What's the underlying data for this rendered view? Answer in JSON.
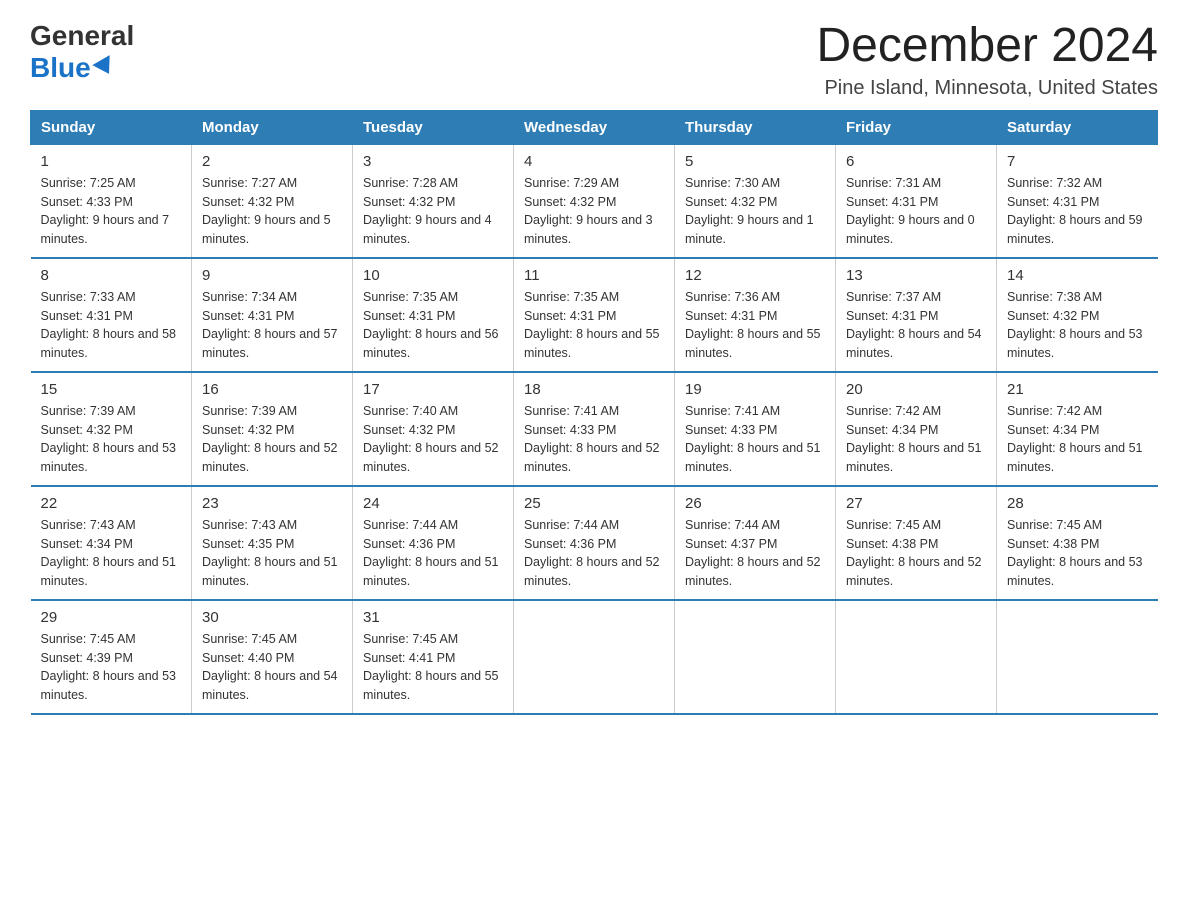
{
  "logo": {
    "general": "General",
    "blue": "Blue"
  },
  "header": {
    "month": "December 2024",
    "location": "Pine Island, Minnesota, United States"
  },
  "days_of_week": [
    "Sunday",
    "Monday",
    "Tuesday",
    "Wednesday",
    "Thursday",
    "Friday",
    "Saturday"
  ],
  "weeks": [
    [
      {
        "day": "1",
        "sunrise": "7:25 AM",
        "sunset": "4:33 PM",
        "daylight": "9 hours and 7 minutes."
      },
      {
        "day": "2",
        "sunrise": "7:27 AM",
        "sunset": "4:32 PM",
        "daylight": "9 hours and 5 minutes."
      },
      {
        "day": "3",
        "sunrise": "7:28 AM",
        "sunset": "4:32 PM",
        "daylight": "9 hours and 4 minutes."
      },
      {
        "day": "4",
        "sunrise": "7:29 AM",
        "sunset": "4:32 PM",
        "daylight": "9 hours and 3 minutes."
      },
      {
        "day": "5",
        "sunrise": "7:30 AM",
        "sunset": "4:32 PM",
        "daylight": "9 hours and 1 minute."
      },
      {
        "day": "6",
        "sunrise": "7:31 AM",
        "sunset": "4:31 PM",
        "daylight": "9 hours and 0 minutes."
      },
      {
        "day": "7",
        "sunrise": "7:32 AM",
        "sunset": "4:31 PM",
        "daylight": "8 hours and 59 minutes."
      }
    ],
    [
      {
        "day": "8",
        "sunrise": "7:33 AM",
        "sunset": "4:31 PM",
        "daylight": "8 hours and 58 minutes."
      },
      {
        "day": "9",
        "sunrise": "7:34 AM",
        "sunset": "4:31 PM",
        "daylight": "8 hours and 57 minutes."
      },
      {
        "day": "10",
        "sunrise": "7:35 AM",
        "sunset": "4:31 PM",
        "daylight": "8 hours and 56 minutes."
      },
      {
        "day": "11",
        "sunrise": "7:35 AM",
        "sunset": "4:31 PM",
        "daylight": "8 hours and 55 minutes."
      },
      {
        "day": "12",
        "sunrise": "7:36 AM",
        "sunset": "4:31 PM",
        "daylight": "8 hours and 55 minutes."
      },
      {
        "day": "13",
        "sunrise": "7:37 AM",
        "sunset": "4:31 PM",
        "daylight": "8 hours and 54 minutes."
      },
      {
        "day": "14",
        "sunrise": "7:38 AM",
        "sunset": "4:32 PM",
        "daylight": "8 hours and 53 minutes."
      }
    ],
    [
      {
        "day": "15",
        "sunrise": "7:39 AM",
        "sunset": "4:32 PM",
        "daylight": "8 hours and 53 minutes."
      },
      {
        "day": "16",
        "sunrise": "7:39 AM",
        "sunset": "4:32 PM",
        "daylight": "8 hours and 52 minutes."
      },
      {
        "day": "17",
        "sunrise": "7:40 AM",
        "sunset": "4:32 PM",
        "daylight": "8 hours and 52 minutes."
      },
      {
        "day": "18",
        "sunrise": "7:41 AM",
        "sunset": "4:33 PM",
        "daylight": "8 hours and 52 minutes."
      },
      {
        "day": "19",
        "sunrise": "7:41 AM",
        "sunset": "4:33 PM",
        "daylight": "8 hours and 51 minutes."
      },
      {
        "day": "20",
        "sunrise": "7:42 AM",
        "sunset": "4:34 PM",
        "daylight": "8 hours and 51 minutes."
      },
      {
        "day": "21",
        "sunrise": "7:42 AM",
        "sunset": "4:34 PM",
        "daylight": "8 hours and 51 minutes."
      }
    ],
    [
      {
        "day": "22",
        "sunrise": "7:43 AM",
        "sunset": "4:34 PM",
        "daylight": "8 hours and 51 minutes."
      },
      {
        "day": "23",
        "sunrise": "7:43 AM",
        "sunset": "4:35 PM",
        "daylight": "8 hours and 51 minutes."
      },
      {
        "day": "24",
        "sunrise": "7:44 AM",
        "sunset": "4:36 PM",
        "daylight": "8 hours and 51 minutes."
      },
      {
        "day": "25",
        "sunrise": "7:44 AM",
        "sunset": "4:36 PM",
        "daylight": "8 hours and 52 minutes."
      },
      {
        "day": "26",
        "sunrise": "7:44 AM",
        "sunset": "4:37 PM",
        "daylight": "8 hours and 52 minutes."
      },
      {
        "day": "27",
        "sunrise": "7:45 AM",
        "sunset": "4:38 PM",
        "daylight": "8 hours and 52 minutes."
      },
      {
        "day": "28",
        "sunrise": "7:45 AM",
        "sunset": "4:38 PM",
        "daylight": "8 hours and 53 minutes."
      }
    ],
    [
      {
        "day": "29",
        "sunrise": "7:45 AM",
        "sunset": "4:39 PM",
        "daylight": "8 hours and 53 minutes."
      },
      {
        "day": "30",
        "sunrise": "7:45 AM",
        "sunset": "4:40 PM",
        "daylight": "8 hours and 54 minutes."
      },
      {
        "day": "31",
        "sunrise": "7:45 AM",
        "sunset": "4:41 PM",
        "daylight": "8 hours and 55 minutes."
      },
      null,
      null,
      null,
      null
    ]
  ],
  "labels": {
    "sunrise": "Sunrise:",
    "sunset": "Sunset:",
    "daylight": "Daylight:"
  }
}
